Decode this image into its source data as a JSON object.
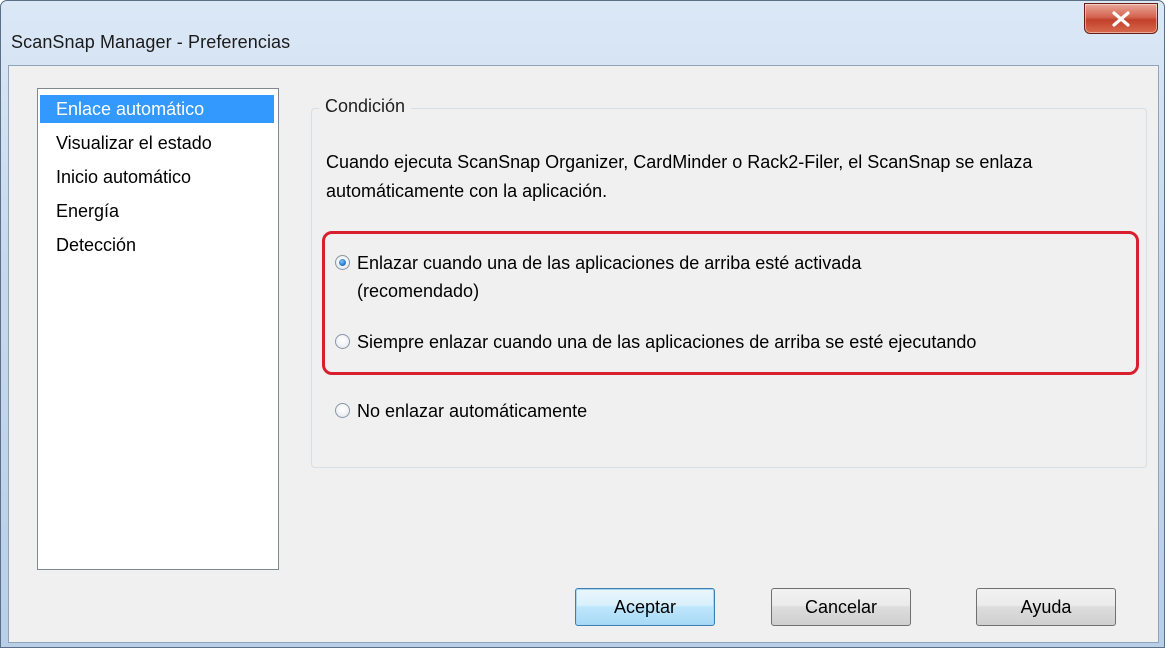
{
  "window": {
    "title": "ScanSnap Manager - Preferencias"
  },
  "sidebar": {
    "items": [
      {
        "label": "Enlace automático",
        "selected": true
      },
      {
        "label": "Visualizar el estado",
        "selected": false
      },
      {
        "label": "Inicio automático",
        "selected": false
      },
      {
        "label": "Energía",
        "selected": false
      },
      {
        "label": "Detección",
        "selected": false
      }
    ]
  },
  "condition": {
    "group_label": "Condición",
    "description": "Cuando ejecuta ScanSnap Organizer, CardMinder o Rack2-Filer, el ScanSnap se enlaza automáticamente con la aplicación.",
    "options": [
      {
        "line1": "Enlazar cuando una de las aplicaciones de arriba esté activada",
        "line2": "(recomendado)",
        "checked": true
      },
      {
        "line1": "Siempre enlazar cuando una de las aplicaciones de arriba se esté ejecutando",
        "line2": "",
        "checked": false
      },
      {
        "line1": "No enlazar automáticamente",
        "line2": "",
        "checked": false
      }
    ]
  },
  "buttons": {
    "accept": "Aceptar",
    "cancel": "Cancelar",
    "help": "Ayuda"
  },
  "colors": {
    "selection": "#3399ff",
    "highlight": "#d91f2d",
    "close_button": "#c2412a"
  },
  "icons": {
    "close": "close-icon"
  }
}
